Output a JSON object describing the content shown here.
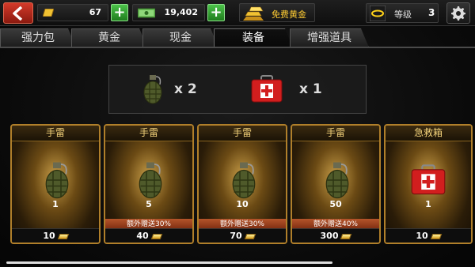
{
  "header": {
    "gold_amount": "67",
    "cash_amount": "19,402",
    "free_gold_label": "免费黄金",
    "level_label": "等级",
    "level_value": "3"
  },
  "tabs": [
    {
      "label": "强力包",
      "active": false
    },
    {
      "label": "黄金",
      "active": false
    },
    {
      "label": "现金",
      "active": false
    },
    {
      "label": "装备",
      "active": true
    },
    {
      "label": "增强道具",
      "active": false
    }
  ],
  "inventory": {
    "grenade_count": "x 2",
    "medkit_count": "x 1"
  },
  "cards": [
    {
      "title": "手雷",
      "item": "grenade",
      "quantity": "1",
      "bonus": "",
      "price": "10"
    },
    {
      "title": "手雷",
      "item": "grenade",
      "quantity": "5",
      "bonus": "额外赠送30%",
      "price": "40"
    },
    {
      "title": "手雷",
      "item": "grenade",
      "quantity": "10",
      "bonus": "额外赠送30%",
      "price": "70"
    },
    {
      "title": "手雷",
      "item": "grenade",
      "quantity": "50",
      "bonus": "额外赠送40%",
      "price": "300"
    },
    {
      "title": "急救箱",
      "item": "medkit",
      "quantity": "1",
      "bonus": "",
      "price": "10"
    }
  ],
  "colors": {
    "accent_gold": "#b07f2a",
    "plus_green": "#4cc24a",
    "back_red": "#d33a2a",
    "bonus_orange": "#b5542a"
  }
}
